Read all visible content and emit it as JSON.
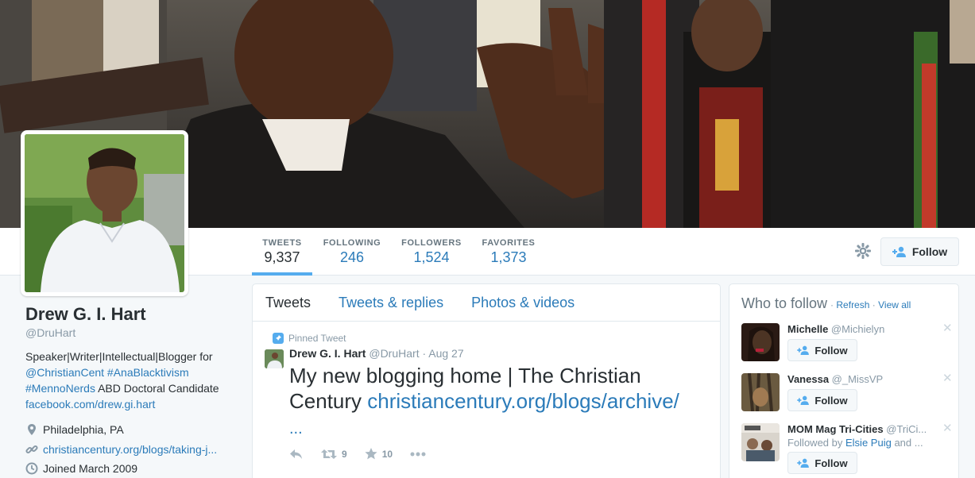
{
  "stats": [
    {
      "label": "TWEETS",
      "value": "9,337",
      "active": true
    },
    {
      "label": "FOLLOWING",
      "value": "246",
      "active": false
    },
    {
      "label": "FOLLOWERS",
      "value": "1,524",
      "active": false
    },
    {
      "label": "FAVORITES",
      "value": "1,373",
      "active": false
    }
  ],
  "follow_button": "Follow",
  "profile": {
    "name": "Drew G. I. Hart",
    "handle": "@DruHart",
    "bio_text": "Speaker|Writer|Intellectual|Blogger for",
    "bio_link1": "@ChristianCent",
    "bio_link2": "#AnaBlacktivism",
    "bio_link3": "#MennoNerds",
    "bio_tail": "ABD Doctoral Candidate",
    "bio_link4": "facebook.com/drew.gi.hart",
    "location": "Philadelphia, PA",
    "website": "christiancentury.org/blogs/taking-j...",
    "joined": "Joined March 2009"
  },
  "tabs": [
    "Tweets",
    "Tweets & replies",
    "Photos & videos"
  ],
  "tweet": {
    "pinned_label": "Pinned Tweet",
    "name": "Drew G. I. Hart",
    "handle": "@DruHart",
    "date": "Aug 27",
    "text": "My new blogging home | The Christian Century",
    "link": "christiancentury.org/blogs/archive/",
    "ellipsis": "...",
    "retweets": "9",
    "favorites": "10"
  },
  "who_to_follow": {
    "title": "Who to follow",
    "refresh": "Refresh",
    "view_all": "View all",
    "separator": "·",
    "suggestions": [
      {
        "name": "Michelle",
        "handle": "@Michielyn",
        "follow": "Follow"
      },
      {
        "name": "Vanessa",
        "handle": "@_MissVP",
        "follow": "Follow"
      },
      {
        "name": "MOM Mag Tri-Cities",
        "handle": "@TriCi...",
        "followed_by_prefix": "Followed by",
        "followed_by_name": "Elsie Puig",
        "followed_by_suffix": "and ...",
        "follow": "Follow"
      }
    ]
  },
  "colors": {
    "link": "#2b7bb9",
    "accent": "#55acee",
    "muted": "#8899a6"
  }
}
